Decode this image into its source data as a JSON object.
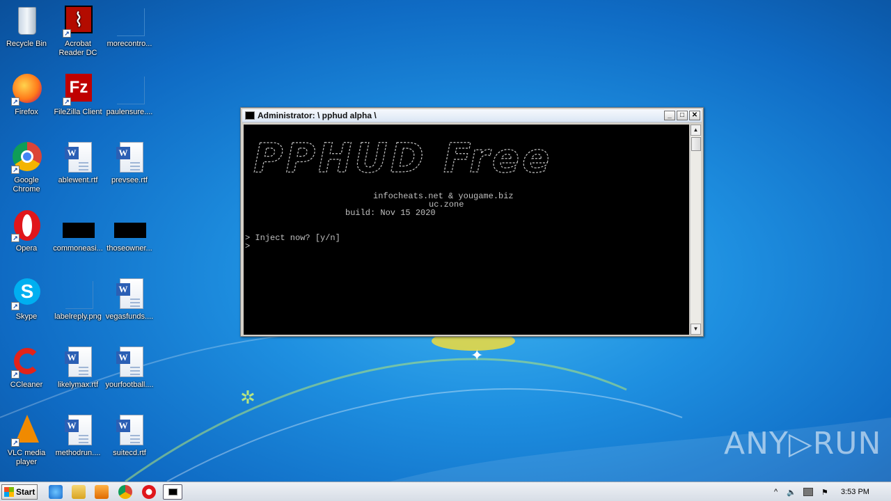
{
  "desktop": {
    "icons": [
      {
        "label": "Recycle Bin",
        "icon": "recycle-bin-icon"
      },
      {
        "label": "Acrobat Reader DC",
        "icon": "acrobat-icon"
      },
      {
        "label": "morecontro...",
        "icon": "blank-file-icon"
      },
      {
        "label": "Firefox",
        "icon": "firefox-icon"
      },
      {
        "label": "FileZilla Client",
        "icon": "filezilla-icon"
      },
      {
        "label": "paulensure....",
        "icon": "blank-file-icon"
      },
      {
        "label": "Google Chrome",
        "icon": "chrome-icon"
      },
      {
        "label": "ablewent.rtf",
        "icon": "word-doc-icon"
      },
      {
        "label": "prevsee.rtf",
        "icon": "word-doc-icon"
      },
      {
        "label": "Opera",
        "icon": "opera-icon"
      },
      {
        "label": "commoneasi...",
        "icon": "black-image-icon"
      },
      {
        "label": "thoseowner...",
        "icon": "black-image-icon"
      },
      {
        "label": "Skype",
        "icon": "skype-icon"
      },
      {
        "label": "labelreply.png",
        "icon": "png-file-icon"
      },
      {
        "label": "vegasfunds....",
        "icon": "word-doc-icon"
      },
      {
        "label": "CCleaner",
        "icon": "ccleaner-icon"
      },
      {
        "label": "likelymax.rtf",
        "icon": "word-doc-icon"
      },
      {
        "label": "yourfootball....",
        "icon": "word-doc-icon"
      },
      {
        "label": "VLC media player",
        "icon": "vlc-icon"
      },
      {
        "label": "methodrun....",
        "icon": "word-doc-icon"
      },
      {
        "label": "suitecd.rtf",
        "icon": "word-doc-icon"
      }
    ]
  },
  "window": {
    "title": "Administrator:  \\ pphud alpha \\",
    "minimize": "_",
    "maximize": "□",
    "close": "✕",
    "console": {
      "banner": "PPHUD Free",
      "line1": "infocheats.net & yougame.biz",
      "line2": "uc.zone",
      "line3": "build: Nov 15 2020",
      "prompt1": "> Inject now? [y/n]",
      "prompt2": ">"
    }
  },
  "watermark": "ANY▷RUN",
  "taskbar": {
    "start_label": "Start",
    "time": "3:53 PM",
    "tray_chevron": "^"
  },
  "colors": {
    "console_bg": "#000000",
    "console_fg": "#c0c0c0",
    "desktop_blue": "#1e8fe0"
  }
}
